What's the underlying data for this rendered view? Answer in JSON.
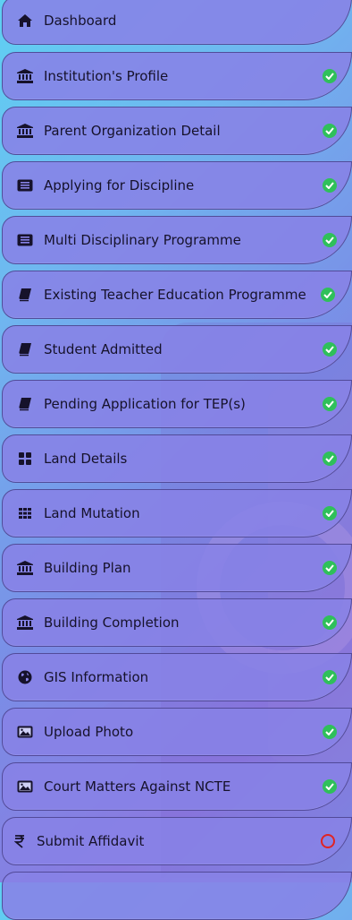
{
  "menu": {
    "items": [
      {
        "label": "Dashboard",
        "icon": "home-icon",
        "status": "none"
      },
      {
        "label": "Institution's Profile",
        "icon": "institution-icon",
        "status": "complete"
      },
      {
        "label": "Parent Organization Detail",
        "icon": "institution-icon",
        "status": "complete"
      },
      {
        "label": "Applying for Discipline",
        "icon": "list-alt-icon",
        "status": "complete"
      },
      {
        "label": "Multi Disciplinary Programme",
        "icon": "list-alt-icon",
        "status": "complete"
      },
      {
        "label": "Existing Teacher Education Programme",
        "icon": "book-icon",
        "status": "complete"
      },
      {
        "label": "Student Admitted",
        "icon": "book-icon",
        "status": "complete"
      },
      {
        "label": "Pending Application for TEP(s)",
        "icon": "book-icon",
        "status": "complete"
      },
      {
        "label": "Land Details",
        "icon": "grid-large-icon",
        "status": "complete"
      },
      {
        "label": "Land Mutation",
        "icon": "grid-small-icon",
        "status": "complete"
      },
      {
        "label": "Building Plan",
        "icon": "institution-icon",
        "status": "complete"
      },
      {
        "label": "Building Completion",
        "icon": "institution-icon",
        "status": "complete"
      },
      {
        "label": "GIS Information",
        "icon": "globe-icon",
        "status": "complete"
      },
      {
        "label": "Upload Photo",
        "icon": "image-icon",
        "status": "complete"
      },
      {
        "label": "Court Matters Against NCTE",
        "icon": "image-icon",
        "status": "complete"
      },
      {
        "label": "Submit Affidavit",
        "icon": "rupee-icon",
        "status": "pending"
      },
      {
        "label": "",
        "icon": "",
        "status": "none"
      }
    ]
  },
  "colors": {
    "complete": "#2fc05a",
    "pending": "#e02424",
    "text": "#16122b"
  }
}
